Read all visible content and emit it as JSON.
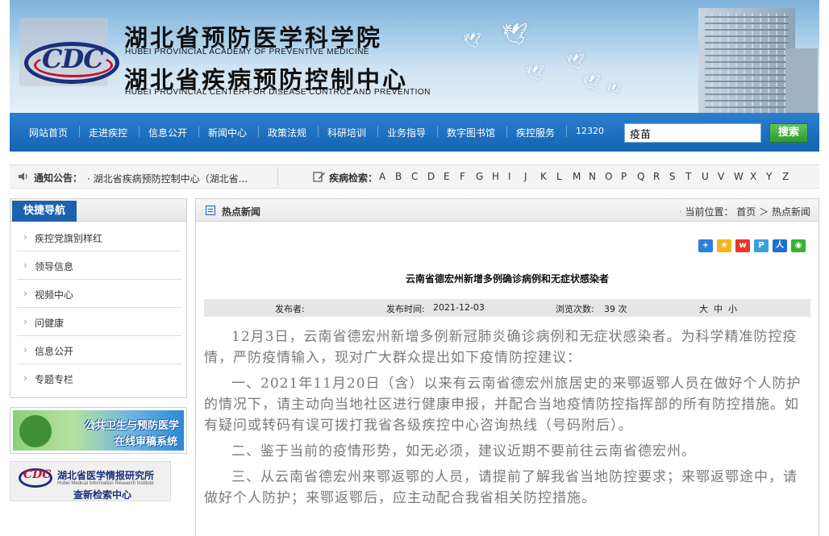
{
  "banner": {
    "title_cn_1": "湖北省预防医学科学院",
    "title_en_1": "HUBEI PROVINCIAL ACADEMY OF PREVENTIVE MEDICINE",
    "title_cn_2": "湖北省疾病预防控制中心",
    "title_en_2": "HUBEI PROVINCIAL CENTER FOR DISEASE CONTROL AND PREVENTION",
    "logo_text": "CDC"
  },
  "nav": {
    "items": [
      "网站首页",
      "走进疾控",
      "信息公开",
      "新闻中心",
      "政策法规",
      "科研培训",
      "业务指导",
      "数字图书馆",
      "疾控服务",
      "12320"
    ],
    "search_value": "疫苗",
    "search_button": "搜索"
  },
  "notice": {
    "label": "通知公告：",
    "text": "· 湖北省疾病预防控制中心（湖北省...",
    "disease_label": "疾病检索：",
    "letters": [
      "A",
      "B",
      "C",
      "D",
      "E",
      "F",
      "G",
      "H",
      "I",
      "J",
      "K",
      "L",
      "M",
      "N",
      "O",
      "P",
      "Q",
      "R",
      "S",
      "T",
      "U",
      "V",
      "W",
      "X",
      "Y",
      "Z"
    ]
  },
  "sidebar": {
    "title": "快捷导航",
    "items": [
      "疾控党旗别样红",
      "领导信息",
      "视频中心",
      "问健康",
      "信息公开",
      "专题专栏"
    ],
    "ad1_line1": "公共卫生与预防医学",
    "ad1_line2": "在线审稿系统",
    "ad2_line1": "湖北省医学情报研究所",
    "ad2_line0": "Hubei Medical Information Research Institute",
    "ad2_line2": "查新检索中心"
  },
  "main": {
    "header_title": "热点新闻",
    "crumb_label": "当前位置：",
    "crumb_home": "首页",
    "crumb_sep": "＞",
    "crumb_current": "热点新闻",
    "article_title": "云南省德宏州新增多例确诊病例和无症状感染者",
    "meta": {
      "publisher_label": "发布者:",
      "time_label": "发布时间:",
      "time_value": "2021-12-03",
      "views_label": "浏览次数:",
      "views_value": "39 次",
      "font_big": "大",
      "font_mid": "中",
      "font_small": "小"
    },
    "paragraphs": [
      "12月3日，云南省德宏州新增多例新冠肺炎确诊病例和无症状感染者。为科学精准防控疫情，严防疫情输入，现对广大群众提出如下疫情防控建议：",
      "一、2021年11月20日（含）以来有云南省德宏州旅居史的来鄂返鄂人员在做好个人防护的情况下，请主动向当地社区进行健康申报，并配合当地疫情防控指挥部的所有防控措施。如有疑问或转码有误可拨打我省各级疾控中心咨询热线（号码附后）。",
      "二、鉴于当前的疫情形势，如无必须，建议近期不要前往云南省德宏州。",
      "三、从云南省德宏州来鄂返鄂的人员，请提前了解我省当地防控要求；来鄂返鄂途中，请做好个人防护；来鄂返鄂后，应主动配合我省相关防控措施。"
    ]
  },
  "colors": {
    "nav_blue": "#1565b3",
    "sidebar_tab_blue": "#1c62ad",
    "search_green": "#2e9b2c"
  },
  "share_icons": [
    "more-icon",
    "qzone-icon",
    "weibo-icon",
    "tencent-icon",
    "renren-icon",
    "wechat-icon"
  ]
}
